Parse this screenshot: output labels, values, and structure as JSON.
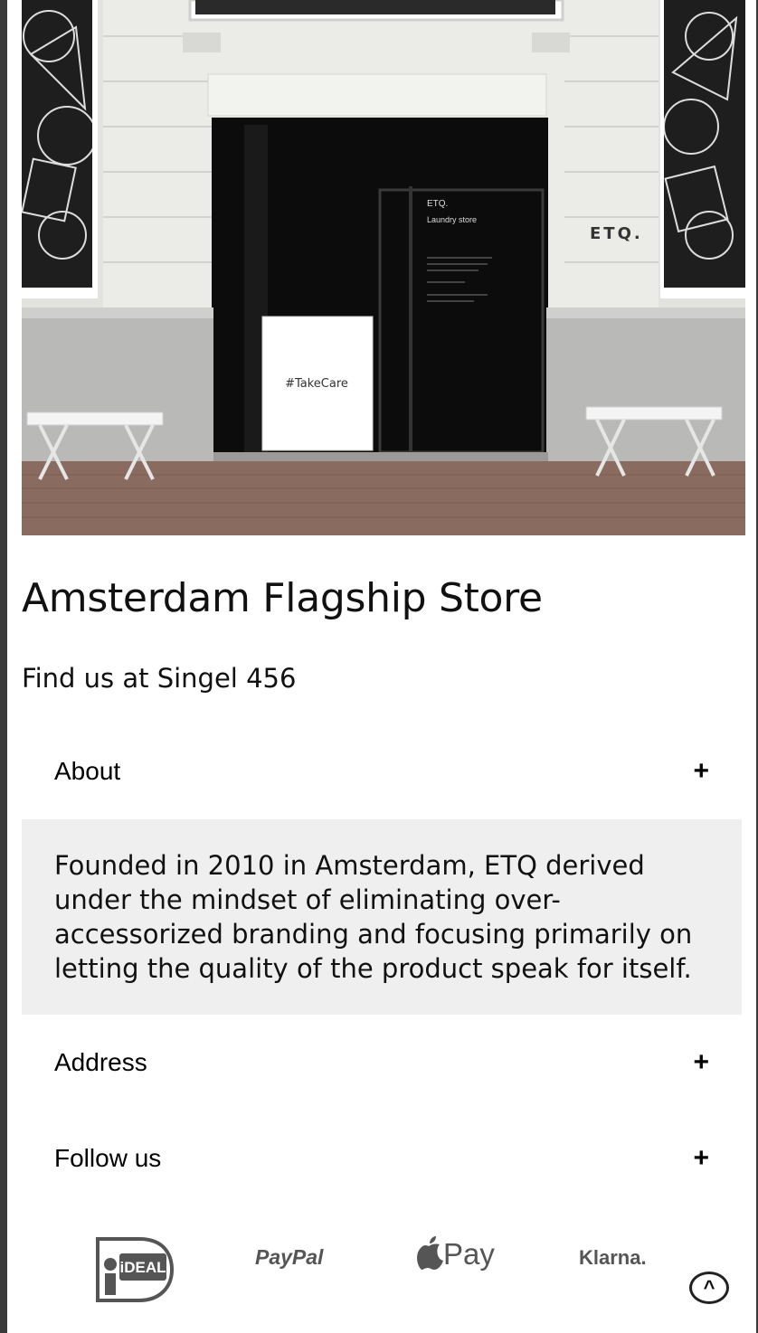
{
  "hero": {
    "sign_text": "ETQ.",
    "window_text_1": "ETQ.",
    "window_text_2": "Laundry store",
    "box_text": "#TakeCare"
  },
  "store": {
    "title": "Amsterdam Flagship Store",
    "subtitle": "Find us at Singel 456"
  },
  "accordion": [
    {
      "label": "About",
      "toggle": "+",
      "expanded": true,
      "body": "Founded in 2010 in Amsterdam, ETQ derived under the mindset of eliminating over-accessorized branding and focusing primarily on letting the quality of the product speak for itself."
    },
    {
      "label": "Address",
      "toggle": "+",
      "expanded": false
    },
    {
      "label": "Follow us",
      "toggle": "+",
      "expanded": false
    }
  ],
  "payments": {
    "ideal": "iDEAL",
    "paypal": "PayPal",
    "applepay": "Pay",
    "klarna": "Klarna."
  },
  "back_to_top": "^",
  "colors": {
    "accordion_body_bg": "#efefef",
    "payment_logo": "#555555"
  }
}
